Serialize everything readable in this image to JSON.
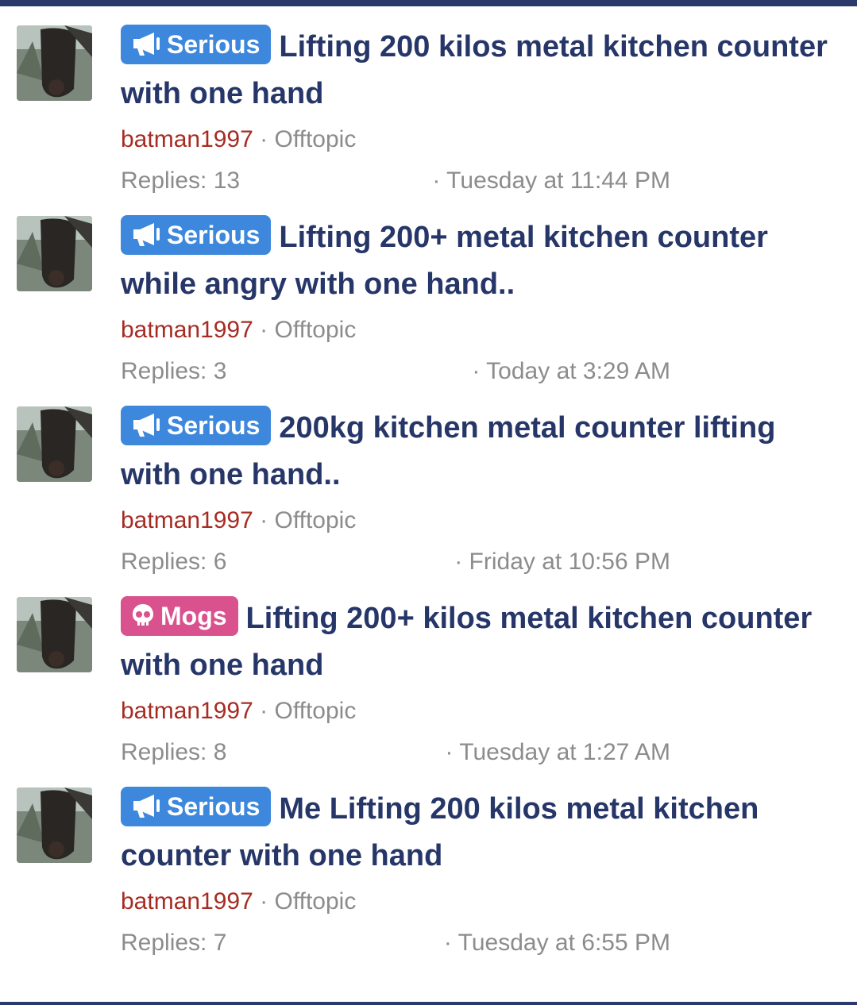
{
  "colors": {
    "top_bar": "#2b3a6b",
    "title": "#263668",
    "username": "#a62c23",
    "meta": "#8c8c8c",
    "prefix_serious": "#3d88dc",
    "prefix_mogs": "#d9528e"
  },
  "threads": [
    {
      "prefix": "Serious",
      "prefix_icon": "megaphone-icon",
      "title": "Lifting 200 kilos metal kitchen counter with one hand",
      "author": "batman1997",
      "separator": " · ",
      "forum": "Offtopic",
      "replies": "Replies: 13",
      "date": "· Tuesday at 11:44 PM"
    },
    {
      "prefix": "Serious",
      "prefix_icon": "megaphone-icon",
      "title": "Lifting 200+ metal kitchen counter while angry with one hand..",
      "author": "batman1997",
      "separator": " · ",
      "forum": "Offtopic",
      "replies": "Replies: 3",
      "date": "· Today at 3:29 AM"
    },
    {
      "prefix": "Serious",
      "prefix_icon": "megaphone-icon",
      "title": "200kg kitchen metal counter lifting with one hand..",
      "author": "batman1997",
      "separator": " · ",
      "forum": "Offtopic",
      "replies": "Replies: 6",
      "date": "· Friday at 10:56 PM"
    },
    {
      "prefix": "Mogs",
      "prefix_icon": "skull-icon",
      "title": "Lifting 200+ kilos metal kitchen counter with one hand",
      "author": "batman1997",
      "separator": " · ",
      "forum": "Offtopic",
      "replies": "Replies: 8",
      "date": "· Tuesday at 1:27 AM"
    },
    {
      "prefix": "Serious",
      "prefix_icon": "megaphone-icon",
      "title": "Me Lifting 200 kilos metal kitchen counter with one hand",
      "author": "batman1997",
      "separator": " · ",
      "forum": "Offtopic",
      "replies": "Replies: 7",
      "date": "· Tuesday at 6:55 PM"
    }
  ]
}
